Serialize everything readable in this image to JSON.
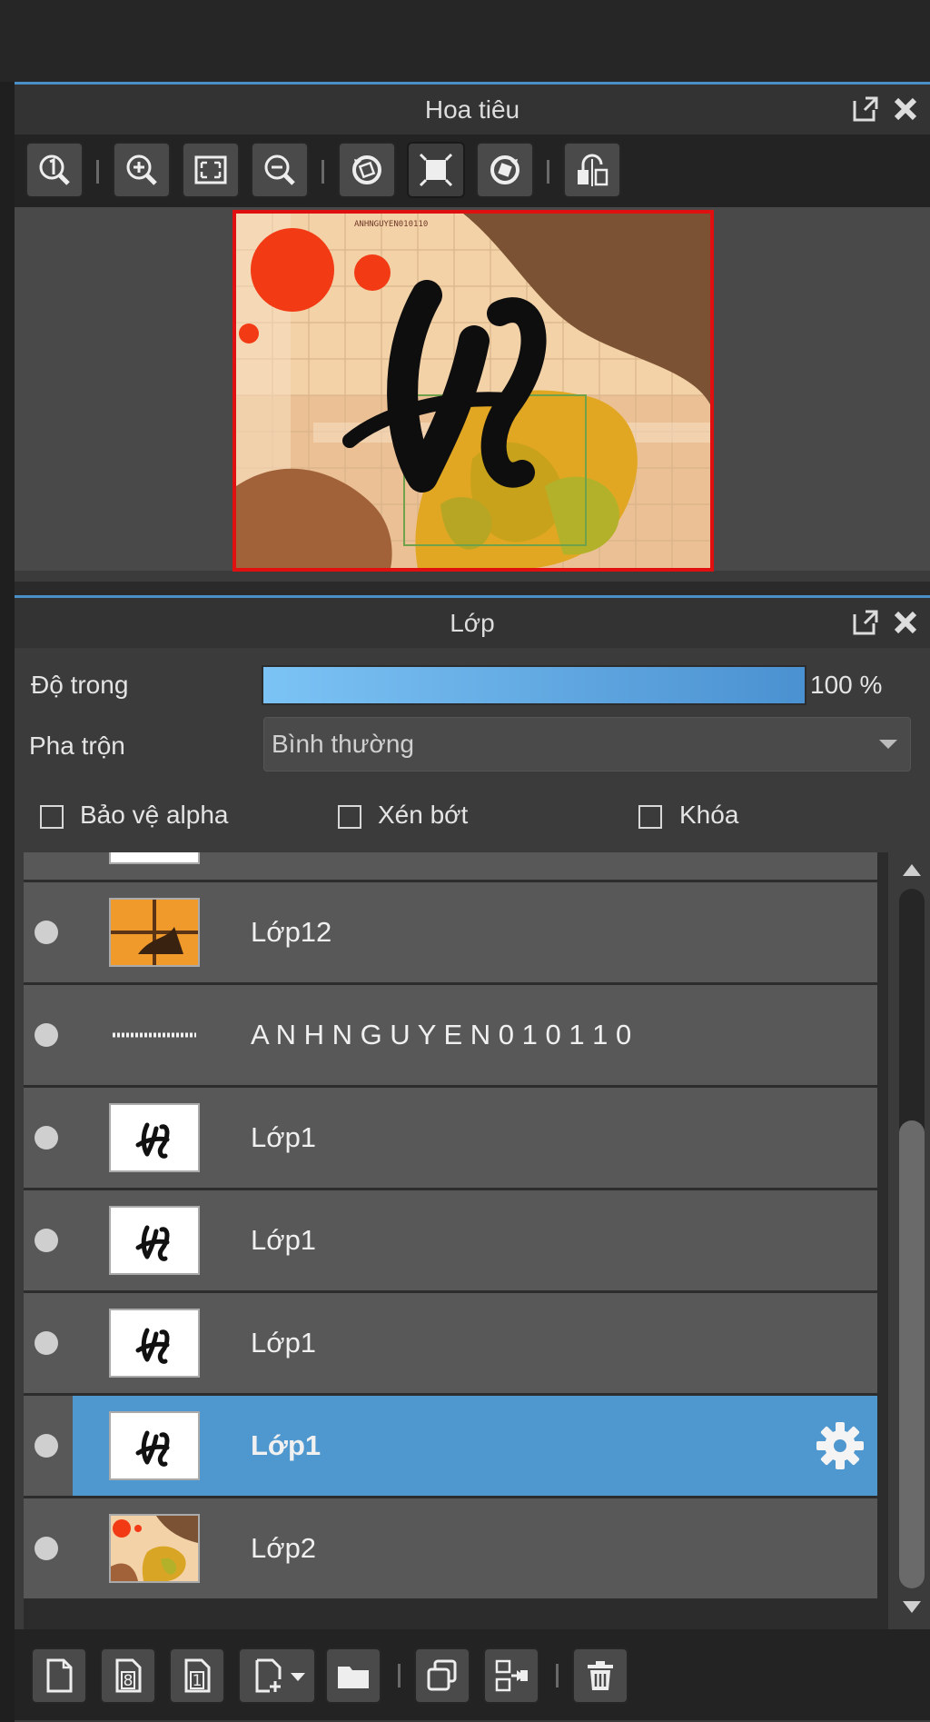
{
  "navigator": {
    "title": "Hoa tiêu",
    "toolbar": [
      "zoom-actual-icon",
      "zoom-in-icon",
      "fit-screen-icon",
      "zoom-out-icon",
      "rotate-left-icon",
      "reset-rotation-icon",
      "rotate-right-icon",
      "flip-horizontal-icon"
    ],
    "preview": {
      "letter": "H",
      "caption": "ANHNGUYEN010110"
    }
  },
  "layers": {
    "title": "Lớp",
    "opacity_label": "Độ trong",
    "opacity_value": "100 %",
    "opacity_fraction": 1.0,
    "blend_label": "Pha trộn",
    "blend_value": "Bình thường",
    "protect_alpha": "Bảo vệ alpha",
    "clipping": "Xén bớt",
    "lock": "Khóa",
    "items": [
      {
        "name": "Lớp12"
      },
      {
        "name": "A N H N G U Y E N 0 1 0 1 1 0"
      },
      {
        "name": "Lớp1"
      },
      {
        "name": "Lớp1"
      },
      {
        "name": "Lớp1"
      },
      {
        "name": "Lớp1",
        "selected": true
      },
      {
        "name": "Lớp2"
      }
    ]
  },
  "colors": {
    "accent": "#4f98cf",
    "preview_border": "#e01010",
    "header_line": "#4a8fc8"
  }
}
